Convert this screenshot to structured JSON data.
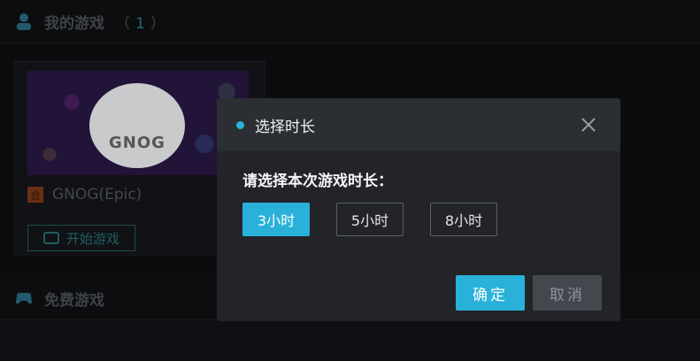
{
  "background": {
    "my_games": {
      "title": "我的游戏",
      "count_open": "（",
      "count": "1",
      "count_close": "）"
    },
    "card": {
      "thumbnail_text": "GNOG",
      "platform_badge": "合",
      "title": "GNOG(Epic)",
      "start_label": "开始游戏"
    },
    "free_games": {
      "title": "免费游戏"
    }
  },
  "dialog": {
    "title": "选择时长",
    "prompt": "请选择本次游戏时长：",
    "options": [
      {
        "label": "3小时",
        "selected": true
      },
      {
        "label": "5小时",
        "selected": false
      },
      {
        "label": "8小时",
        "selected": false
      }
    ],
    "confirm_label": "确定",
    "cancel_label": "取消"
  },
  "colors": {
    "accent": "#29b1d9",
    "dialog_bg": "#222428",
    "header_bg": "#2b2e33"
  },
  "icons": {
    "my_games": "gamer-icon",
    "free_games": "gamepad-icon",
    "close": "close-icon"
  }
}
